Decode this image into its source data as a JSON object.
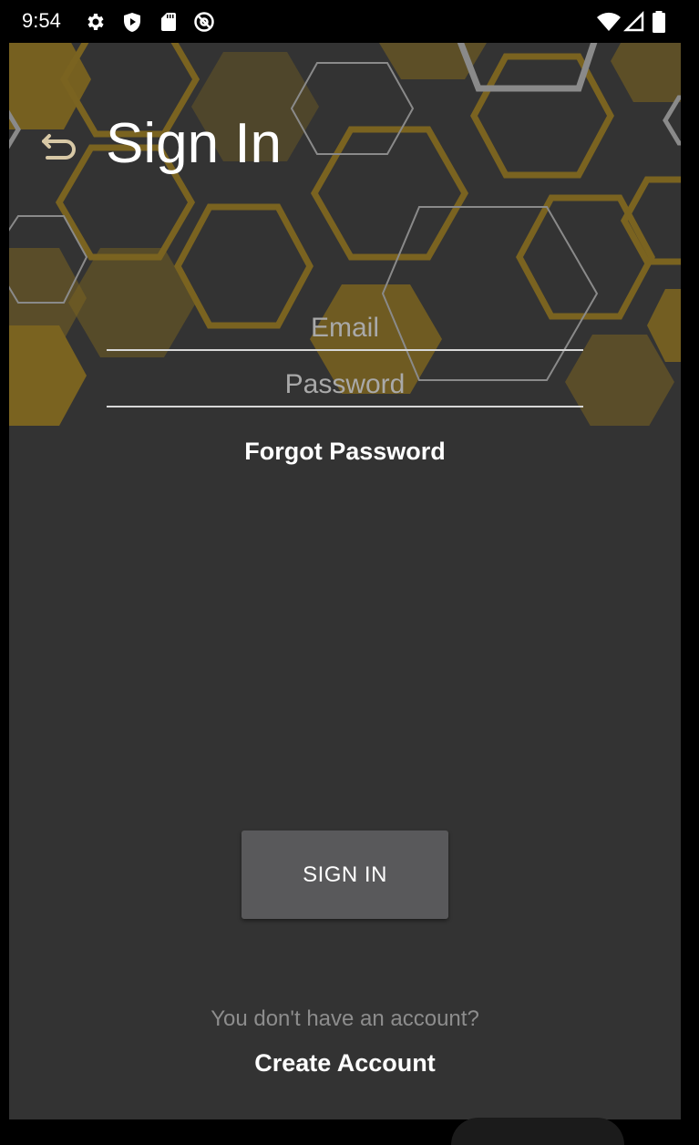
{
  "status_bar": {
    "time": "9:54",
    "left_icons": [
      "settings-icon",
      "shield-play-icon",
      "sd-card-icon",
      "at-sign-icon"
    ],
    "right_icons": [
      "wifi-icon",
      "signal-icon",
      "battery-icon"
    ]
  },
  "header": {
    "title": "Sign In",
    "back_icon": "undo-arrow-icon"
  },
  "form": {
    "email_placeholder": "Email",
    "email_value": "",
    "password_placeholder": "Password",
    "password_value": "",
    "forgot_label": "Forgot Password"
  },
  "actions": {
    "sign_in_label": "SIGN IN",
    "no_account_text": "You don't have an account?",
    "create_account_label": "Create Account"
  },
  "colors": {
    "background": "#333333",
    "hex_gold": "#7a6320",
    "hex_grey": "#8a8a8a",
    "button": "#59595b"
  }
}
